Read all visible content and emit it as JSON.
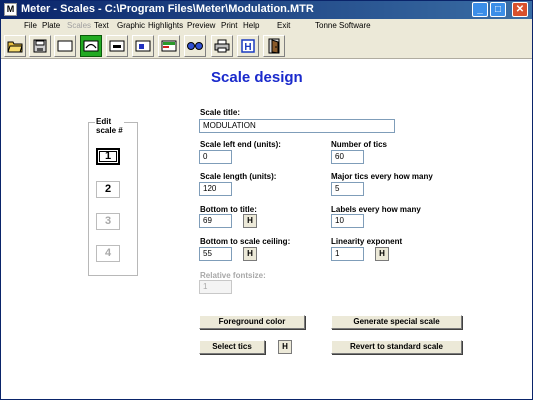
{
  "window": {
    "title": "Meter - Scales - C:\\Program Files\\Meter\\Modulation.MTR",
    "app_icon": "M",
    "controls": {
      "minimize": "_",
      "maximize": "□",
      "close": "✕"
    }
  },
  "menu": {
    "file": "File",
    "plate": "Plate",
    "scales": "Scales",
    "text": "Text",
    "graphic": "Graphic",
    "highlights": "Highlights",
    "preview": "Preview",
    "print": "Print",
    "help": "Help",
    "exit": "Exit",
    "company": "Tonne Software"
  },
  "toolbar": {
    "icons": [
      "open-folder-icon",
      "save-disk-icon",
      "plate-rect-icon",
      "scale-arc-icon",
      "text-tool-icon",
      "graphic-tool-icon",
      "highlight-tool-icon",
      "preview-glasses-icon",
      "print-icon",
      "help-icon",
      "exit-door-icon"
    ],
    "help_label": "H",
    "active_color": "#22aa22"
  },
  "heading": "Scale design",
  "edit_scale": {
    "legend_line1": "Edit",
    "legend_line2": "scale #",
    "buttons": [
      "1",
      "2",
      "3",
      "4"
    ]
  },
  "form": {
    "scale_title_label": "Scale title:",
    "scale_title_value": "MODULATION",
    "left_end_label": "Scale left end (units):",
    "left_end_value": "0",
    "number_tics_label": "Number of tics",
    "number_tics_value": "60",
    "length_label": "Scale length (units):",
    "length_value": "120",
    "major_tics_label": "Major tics every how many",
    "major_tics_value": "5",
    "bottom_title_label": "Bottom to title:",
    "bottom_title_value": "69",
    "labels_every_label": "Labels every how many",
    "labels_every_value": "10",
    "bottom_ceiling_label": "Bottom to scale ceiling:",
    "bottom_ceiling_value": "55",
    "linearity_label": "Linearity exponent",
    "linearity_value": "1",
    "rel_fontsize_label": "Relative fontsize:",
    "rel_fontsize_value": "1",
    "h_label": "H"
  },
  "buttons": {
    "foreground_color": "Foreground color",
    "generate_special": "Generate special scale",
    "select_tics": "Select tics",
    "revert_standard": "Revert to standard scale"
  },
  "colors": {
    "heading": "#1a2acc",
    "titlebar": "#0a246a"
  }
}
